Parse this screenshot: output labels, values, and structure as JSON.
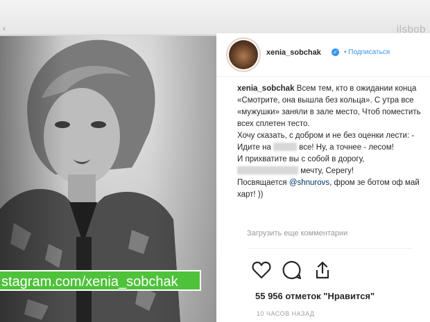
{
  "header": {
    "brand": "ilsbob"
  },
  "photo": {
    "url_label": "stagram.com/xenia_sobchak"
  },
  "post": {
    "username": "xenia_sobchak",
    "verified_badge": "✓",
    "follow_label": "• Подписаться",
    "caption": {
      "author": "xenia_sobchak",
      "line1": "Всем тем, кто в ожидании конца «Смотрите, она вышла без кольца». С утра все «мужушки» заняли в зале место, Чтоб поместить всех сплетен тесто.",
      "line2a": "Хочу сказать, с добром и не без оценки лести: - Идите на",
      "line2b": "все! Ну, а точнее - лесом!",
      "line3a": "И прихватите вы с собой в дорогу,",
      "line3b": "мечту, Серегу!",
      "line4a": "Посвящается",
      "mention": "@shnurovs",
      "line4b": ", фром зе ботом оф май харт! ))"
    },
    "comments_link": "Загрузить еще комментарии",
    "likes": "55 956 отметок \"Нравится\"",
    "time_ago": "10 ЧАСОВ НАЗАД"
  },
  "colors": {
    "accent_green": "#4ec23a",
    "link_blue": "#3897f0"
  }
}
